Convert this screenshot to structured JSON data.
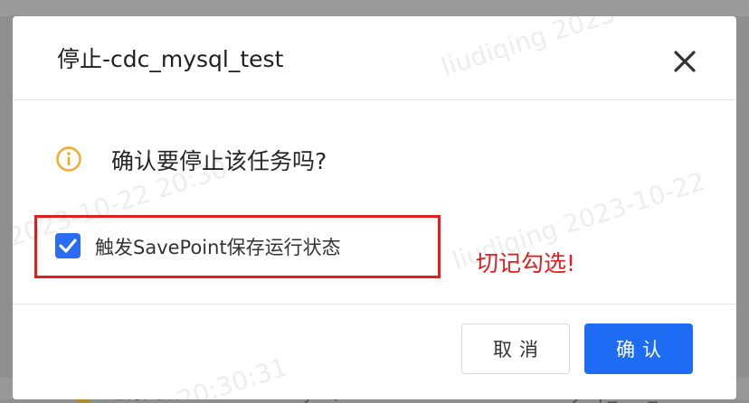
{
  "dialog": {
    "title": "停止-cdc_mysql_test",
    "confirm_question": "确认要停止该任务吗?",
    "checkbox_label": "触发SavePoint保存运行状态",
    "checkbox_checked": true,
    "note": "切记勾选!",
    "cancel_label": "取消",
    "ok_label": "确认"
  },
  "watermarks": [
    "liudiqing 2023",
    "2023-10-22 20:30",
    "liudiqing 2023-10-22",
    "20:30:31"
  ],
  "background_row": {
    "status": "运行失败",
    "type": "MySQL",
    "name": "mysql_cdc_test"
  },
  "colors": {
    "primary": "#1f6cf4",
    "note_red": "#e02020",
    "info_orange": "#f5a623"
  }
}
